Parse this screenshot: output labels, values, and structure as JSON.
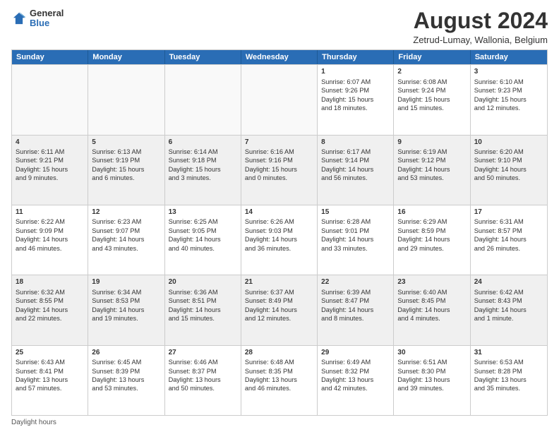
{
  "logo": {
    "general": "General",
    "blue": "Blue"
  },
  "title": "August 2024",
  "subtitle": "Zetrud-Lumay, Wallonia, Belgium",
  "header_days": [
    "Sunday",
    "Monday",
    "Tuesday",
    "Wednesday",
    "Thursday",
    "Friday",
    "Saturday"
  ],
  "footer": "Daylight hours",
  "weeks": [
    [
      {
        "day": "",
        "info": ""
      },
      {
        "day": "",
        "info": ""
      },
      {
        "day": "",
        "info": ""
      },
      {
        "day": "",
        "info": ""
      },
      {
        "day": "1",
        "info": "Sunrise: 6:07 AM\nSunset: 9:26 PM\nDaylight: 15 hours\nand 18 minutes."
      },
      {
        "day": "2",
        "info": "Sunrise: 6:08 AM\nSunset: 9:24 PM\nDaylight: 15 hours\nand 15 minutes."
      },
      {
        "day": "3",
        "info": "Sunrise: 6:10 AM\nSunset: 9:23 PM\nDaylight: 15 hours\nand 12 minutes."
      }
    ],
    [
      {
        "day": "4",
        "info": "Sunrise: 6:11 AM\nSunset: 9:21 PM\nDaylight: 15 hours\nand 9 minutes."
      },
      {
        "day": "5",
        "info": "Sunrise: 6:13 AM\nSunset: 9:19 PM\nDaylight: 15 hours\nand 6 minutes."
      },
      {
        "day": "6",
        "info": "Sunrise: 6:14 AM\nSunset: 9:18 PM\nDaylight: 15 hours\nand 3 minutes."
      },
      {
        "day": "7",
        "info": "Sunrise: 6:16 AM\nSunset: 9:16 PM\nDaylight: 15 hours\nand 0 minutes."
      },
      {
        "day": "8",
        "info": "Sunrise: 6:17 AM\nSunset: 9:14 PM\nDaylight: 14 hours\nand 56 minutes."
      },
      {
        "day": "9",
        "info": "Sunrise: 6:19 AM\nSunset: 9:12 PM\nDaylight: 14 hours\nand 53 minutes."
      },
      {
        "day": "10",
        "info": "Sunrise: 6:20 AM\nSunset: 9:10 PM\nDaylight: 14 hours\nand 50 minutes."
      }
    ],
    [
      {
        "day": "11",
        "info": "Sunrise: 6:22 AM\nSunset: 9:09 PM\nDaylight: 14 hours\nand 46 minutes."
      },
      {
        "day": "12",
        "info": "Sunrise: 6:23 AM\nSunset: 9:07 PM\nDaylight: 14 hours\nand 43 minutes."
      },
      {
        "day": "13",
        "info": "Sunrise: 6:25 AM\nSunset: 9:05 PM\nDaylight: 14 hours\nand 40 minutes."
      },
      {
        "day": "14",
        "info": "Sunrise: 6:26 AM\nSunset: 9:03 PM\nDaylight: 14 hours\nand 36 minutes."
      },
      {
        "day": "15",
        "info": "Sunrise: 6:28 AM\nSunset: 9:01 PM\nDaylight: 14 hours\nand 33 minutes."
      },
      {
        "day": "16",
        "info": "Sunrise: 6:29 AM\nSunset: 8:59 PM\nDaylight: 14 hours\nand 29 minutes."
      },
      {
        "day": "17",
        "info": "Sunrise: 6:31 AM\nSunset: 8:57 PM\nDaylight: 14 hours\nand 26 minutes."
      }
    ],
    [
      {
        "day": "18",
        "info": "Sunrise: 6:32 AM\nSunset: 8:55 PM\nDaylight: 14 hours\nand 22 minutes."
      },
      {
        "day": "19",
        "info": "Sunrise: 6:34 AM\nSunset: 8:53 PM\nDaylight: 14 hours\nand 19 minutes."
      },
      {
        "day": "20",
        "info": "Sunrise: 6:36 AM\nSunset: 8:51 PM\nDaylight: 14 hours\nand 15 minutes."
      },
      {
        "day": "21",
        "info": "Sunrise: 6:37 AM\nSunset: 8:49 PM\nDaylight: 14 hours\nand 12 minutes."
      },
      {
        "day": "22",
        "info": "Sunrise: 6:39 AM\nSunset: 8:47 PM\nDaylight: 14 hours\nand 8 minutes."
      },
      {
        "day": "23",
        "info": "Sunrise: 6:40 AM\nSunset: 8:45 PM\nDaylight: 14 hours\nand 4 minutes."
      },
      {
        "day": "24",
        "info": "Sunrise: 6:42 AM\nSunset: 8:43 PM\nDaylight: 14 hours\nand 1 minute."
      }
    ],
    [
      {
        "day": "25",
        "info": "Sunrise: 6:43 AM\nSunset: 8:41 PM\nDaylight: 13 hours\nand 57 minutes."
      },
      {
        "day": "26",
        "info": "Sunrise: 6:45 AM\nSunset: 8:39 PM\nDaylight: 13 hours\nand 53 minutes."
      },
      {
        "day": "27",
        "info": "Sunrise: 6:46 AM\nSunset: 8:37 PM\nDaylight: 13 hours\nand 50 minutes."
      },
      {
        "day": "28",
        "info": "Sunrise: 6:48 AM\nSunset: 8:35 PM\nDaylight: 13 hours\nand 46 minutes."
      },
      {
        "day": "29",
        "info": "Sunrise: 6:49 AM\nSunset: 8:32 PM\nDaylight: 13 hours\nand 42 minutes."
      },
      {
        "day": "30",
        "info": "Sunrise: 6:51 AM\nSunset: 8:30 PM\nDaylight: 13 hours\nand 39 minutes."
      },
      {
        "day": "31",
        "info": "Sunrise: 6:53 AM\nSunset: 8:28 PM\nDaylight: 13 hours\nand 35 minutes."
      }
    ]
  ]
}
